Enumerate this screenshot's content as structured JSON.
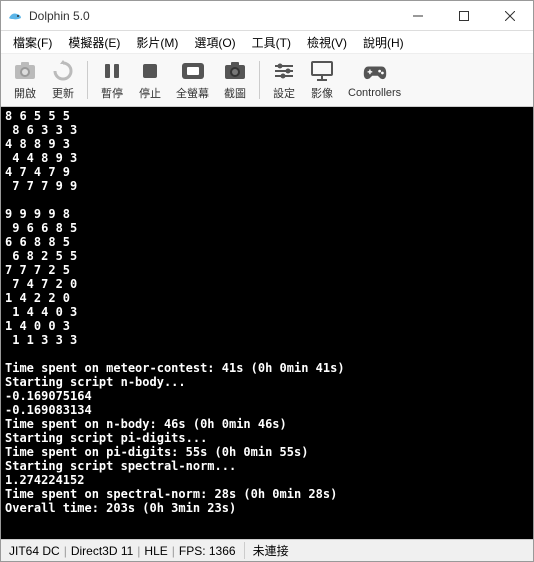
{
  "title": "Dolphin 5.0",
  "menus": [
    "檔案(F)",
    "模擬器(E)",
    "影片(M)",
    "選項(O)",
    "工具(T)",
    "檢視(V)",
    "說明(H)"
  ],
  "toolbar": {
    "open": "開啟",
    "refresh": "更新",
    "pause": "暫停",
    "stop": "停止",
    "fullscreen": "全螢幕",
    "screenshot": "截圖",
    "settings": "設定",
    "video": "影像",
    "controllers": "Controllers"
  },
  "console_text": "8 6 5 5 5\n 8 6 3 3 3\n4 8 8 9 3\n 4 4 8 9 3\n4 7 4 7 9\n 7 7 7 9 9\n\n9 9 9 9 8\n 9 6 6 8 5\n6 6 8 8 5\n 6 8 2 5 5\n7 7 7 2 5\n 7 4 7 2 0\n1 4 2 2 0\n 1 4 4 0 3\n1 4 0 0 3\n 1 1 3 3 3\n\nTime spent on meteor-contest: 41s (0h 0min 41s)\nStarting script n-body...\n-0.169075164\n-0.169083134\nTime spent on n-body: 46s (0h 0min 46s)\nStarting script pi-digits...\nTime spent on pi-digits: 55s (0h 0min 55s)\nStarting script spectral-norm...\n1.274224152\nTime spent on spectral-norm: 28s (0h 0min 28s)\nOverall time: 203s (0h 3min 23s)",
  "status": {
    "jit": "JIT64 DC",
    "renderer": "Direct3D 11",
    "mode": "HLE",
    "fps": "FPS: 1366",
    "connection": "未連接"
  }
}
